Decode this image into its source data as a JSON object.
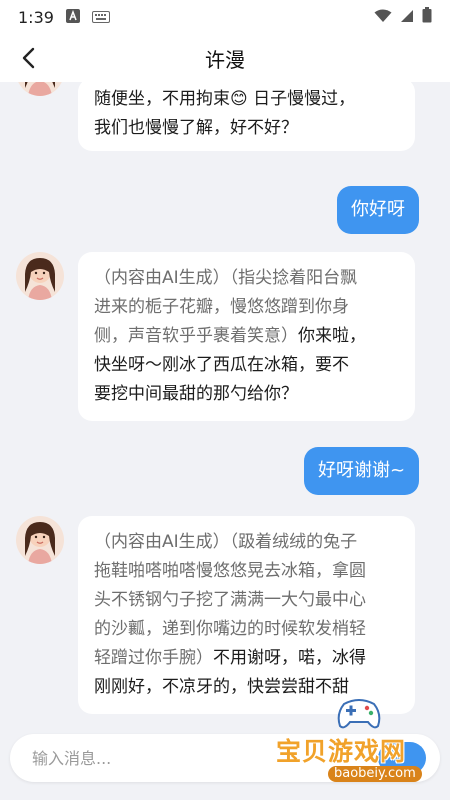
{
  "status_bar": {
    "time": "1:39"
  },
  "header": {
    "title": "许漫"
  },
  "messages": [
    {
      "role": "ai",
      "text_lines": [
        "随便坐，不用拘束😊 日子慢慢过，",
        "我们也慢慢了解，好不好？"
      ]
    },
    {
      "role": "user",
      "text": "你好呀"
    },
    {
      "role": "ai",
      "gen_lines": [
        "（内容由AI生成）（指尖捻着阳台飘",
        "进来的栀子花瓣，慢悠悠蹭到你身",
        "侧，声音软乎乎裹着笑意）"
      ],
      "speech_inline": "你来啦，",
      "speech_lines": [
        "快坐呀～刚冰了西瓜在冰箱，要不",
        "要挖中间最甜的那勺给你？"
      ]
    },
    {
      "role": "user",
      "text": "好呀谢谢~"
    },
    {
      "role": "ai",
      "gen_lines": [
        "（内容由AI生成）（趿着绒绒的兔子",
        "拖鞋啪嗒啪嗒慢悠悠晃去冰箱，拿圆",
        "头不锈钢勺子挖了满满一大勺最中心",
        "的沙瓤，递到你嘴边的时候软发梢轻",
        "轻蹭过你手腕）"
      ],
      "speech_inline": "不用谢呀，喏，冰得",
      "speech_lines": [
        "刚刚好，不凉牙的，快尝尝甜不甜"
      ]
    }
  ],
  "input": {
    "placeholder": "输入消息..."
  },
  "watermark": {
    "text": "宝贝游戏网",
    "url": "baobeiy.com"
  },
  "colors": {
    "accent": "#3f95f0",
    "background": "#f1f2f6",
    "bubble_ai": "#ffffff",
    "generated_text": "#6e6e6e"
  }
}
